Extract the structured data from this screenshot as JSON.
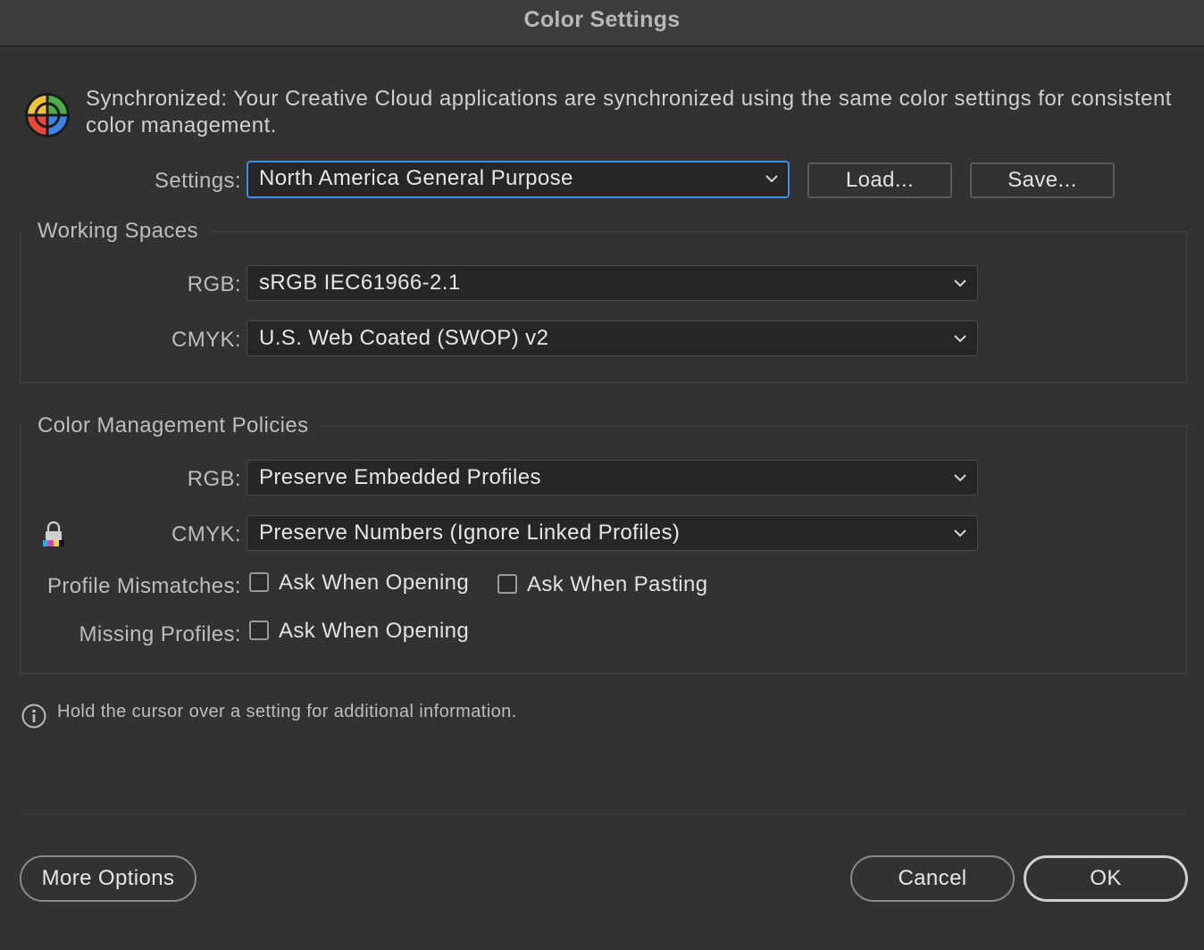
{
  "window": {
    "title": "Color Settings"
  },
  "sync": {
    "message": "Synchronized: Your Creative Cloud applications are synchronized using the same color settings for consistent color management.",
    "icon": "color-sync-icon"
  },
  "settings": {
    "label": "Settings:",
    "value": "North America General Purpose",
    "load_label": "Load...",
    "save_label": "Save..."
  },
  "working_spaces": {
    "title": "Working Spaces",
    "rgb_label": "RGB:",
    "rgb_value": "sRGB IEC61966-2.1",
    "cmyk_label": "CMYK:",
    "cmyk_value": "U.S. Web Coated (SWOP) v2"
  },
  "policies": {
    "title": "Color Management Policies",
    "rgb_label": "RGB:",
    "rgb_value": "Preserve Embedded Profiles",
    "cmyk_label": "CMYK:",
    "cmyk_value": "Preserve Numbers (Ignore Linked Profiles)",
    "mismatches_label": "Profile Mismatches:",
    "mismatch_opening_label": "Ask When Opening",
    "mismatch_opening_checked": false,
    "mismatch_pasting_label": "Ask When Pasting",
    "mismatch_pasting_checked": false,
    "missing_label": "Missing Profiles:",
    "missing_opening_label": "Ask When Opening",
    "missing_opening_checked": false
  },
  "info": {
    "text": "Hold the cursor over a setting for additional information."
  },
  "footer": {
    "more_options_label": "More Options",
    "cancel_label": "Cancel",
    "ok_label": "OK"
  },
  "colors": {
    "background": "#323232",
    "titlebar": "#3d3d3d",
    "focus_ring": "#3d8ee8",
    "field_bg": "#262626"
  }
}
